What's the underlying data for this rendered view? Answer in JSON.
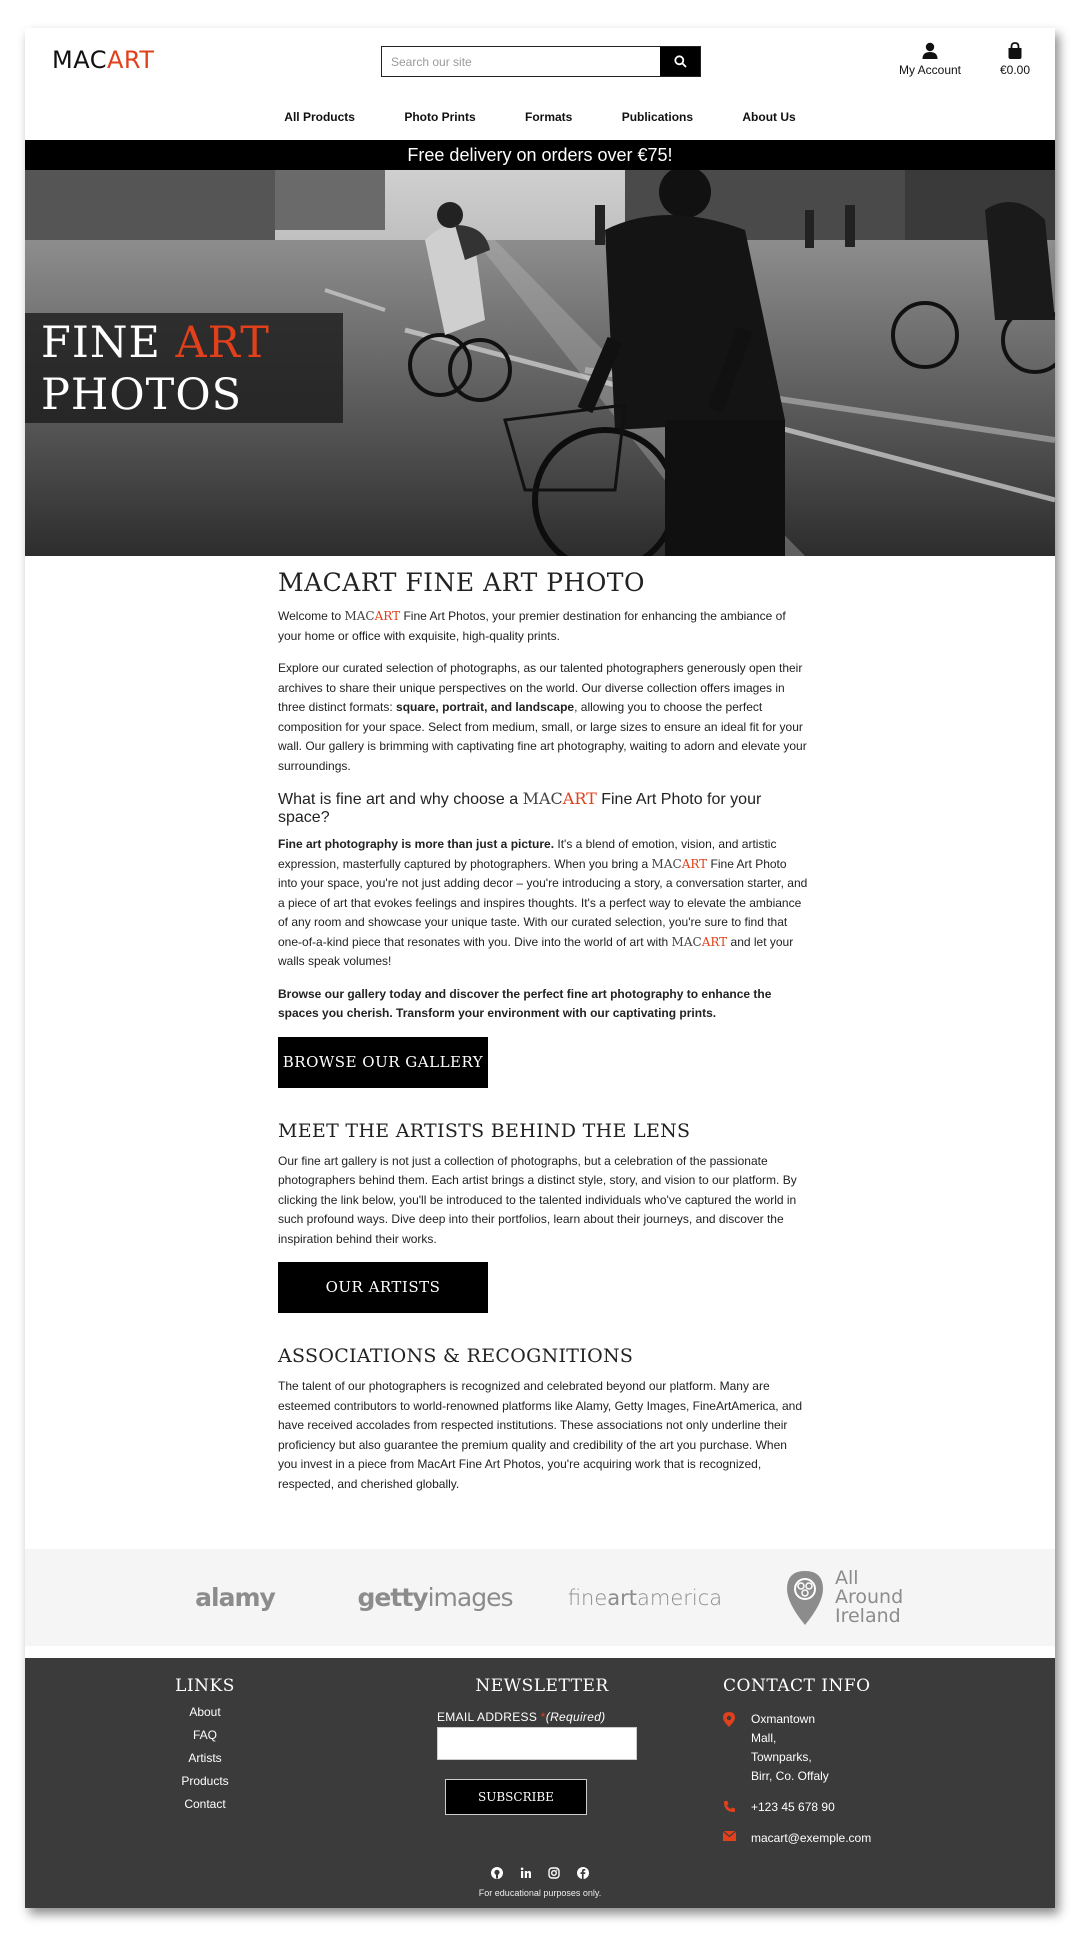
{
  "header": {
    "logo_mac": "MAC",
    "logo_art": "ART",
    "search_placeholder": "Search our site",
    "account_label": "My Account",
    "cart_total": "€0.00"
  },
  "nav": [
    "All Products",
    "Photo Prints",
    "Formats",
    "Publications",
    "About Us"
  ],
  "banner": "Free delivery on orders over €75!",
  "hero": {
    "line1_a": "FINE ",
    "line1_b": "ART",
    "line2": "PHOTOS"
  },
  "intro": {
    "title": "MACART FINE ART PHOTO",
    "p1_a": "Welcome to ",
    "p1_brand_m": "MAC",
    "p1_brand_a": "ART",
    "p1_b": " Fine Art Photos, your premier destination for enhancing the ambiance of your home or office with exquisite, high-quality prints.",
    "p2_a": "Explore our curated selection of photographs, as our talented photographers generously open their archives to share their unique perspectives on the world. Our diverse collection offers images in three distinct formats: ",
    "p2_bold": "square, portrait, and landscape",
    "p2_b": ", allowing you to choose the perfect composition for your space. Select from medium, small, or large sizes to ensure an ideal fit for your wall. Our gallery is brimming with captivating fine art photography, waiting to adorn and elevate your surroundings."
  },
  "why": {
    "q_a": "What is fine art and why choose a ",
    "q_brand_m": "MAC",
    "q_brand_a": "ART",
    "q_b": " Fine Art Photo for your space?",
    "p1_bold": "Fine art photography is more than just a picture.",
    "p1_a": " It's a blend of emotion, vision, and artistic expression, masterfully captured by photographers. When you bring a ",
    "p1_brand_m": "MAC",
    "p1_brand_a": "ART",
    "p1_b": " Fine Art Photo into your space, you're not just adding decor – you're introducing a story, a conversation starter, and a piece of art that evokes feelings and inspires thoughts. It's a perfect way to elevate the ambiance of any room and showcase your unique taste. With our curated selection, you're sure to find that one-of-a-kind piece that resonates with you. Dive into the world of art with ",
    "p1_brand2_m": "MAC",
    "p1_brand2_a": "ART",
    "p1_c": " and let your walls speak volumes!",
    "p2_bold": "Browse our gallery today and discover the perfect fine art photography to enhance the spaces you cherish. Transform your environment with our captivating prints.",
    "button": "BROWSE OUR GALLERY"
  },
  "artists": {
    "title": "MEET THE ARTISTS BEHIND THE LENS",
    "p": "Our fine art gallery is not just a collection of photographs, but a celebration of the passionate photographers behind them. Each artist brings a distinct style, story, and vision to our platform. By clicking the link below, you'll be introduced to the talented individuals who've captured the world in such profound ways. Dive deep into their portfolios, learn about their journeys, and discover the inspiration behind their works.",
    "button": "OUR ARTISTS"
  },
  "associations": {
    "title": "ASSOCIATIONS & RECOGNITIONS",
    "p": "The talent of our photographers is recognized and celebrated beyond our platform. Many are esteemed contributors to world-renowned platforms like Alamy, Getty Images, FineArtAmerica, and have received accolades from respected institutions. These associations not only underline their proficiency but also guarantee the premium quality and credibility of the art you purchase. When you invest in a piece from MacArt Fine Art Photos, you're acquiring work that is recognized, respected, and cherished globally."
  },
  "partners": {
    "alamy": "alamy",
    "getty_a": "getty",
    "getty_b": "images",
    "fine_a": "fine",
    "fine_b": "art",
    "fine_c": "america",
    "aai_1": "All",
    "aai_2": "Around",
    "aai_3": "Ireland"
  },
  "footer": {
    "links_title": "LINKS",
    "links": [
      "About",
      "FAQ",
      "Artists",
      "Products",
      "Contact"
    ],
    "newsletter_title": "NEWSLETTER",
    "email_label": "EMAIL ADDRESS",
    "required_star": "*",
    "required": "(Required)",
    "subscribe": "SUBSCRIBE",
    "contact_title": "CONTACT INFO",
    "address": "Oxmantown Mall, Townparks, Birr, Co. Offaly",
    "phone": "+123 45 678 90",
    "email": "macart@exemple.com",
    "edu": "For educational purposes only."
  },
  "colors": {
    "accent": "#e0401b",
    "footer_bg": "#3b3b3b",
    "banner_bg": "#000000"
  }
}
